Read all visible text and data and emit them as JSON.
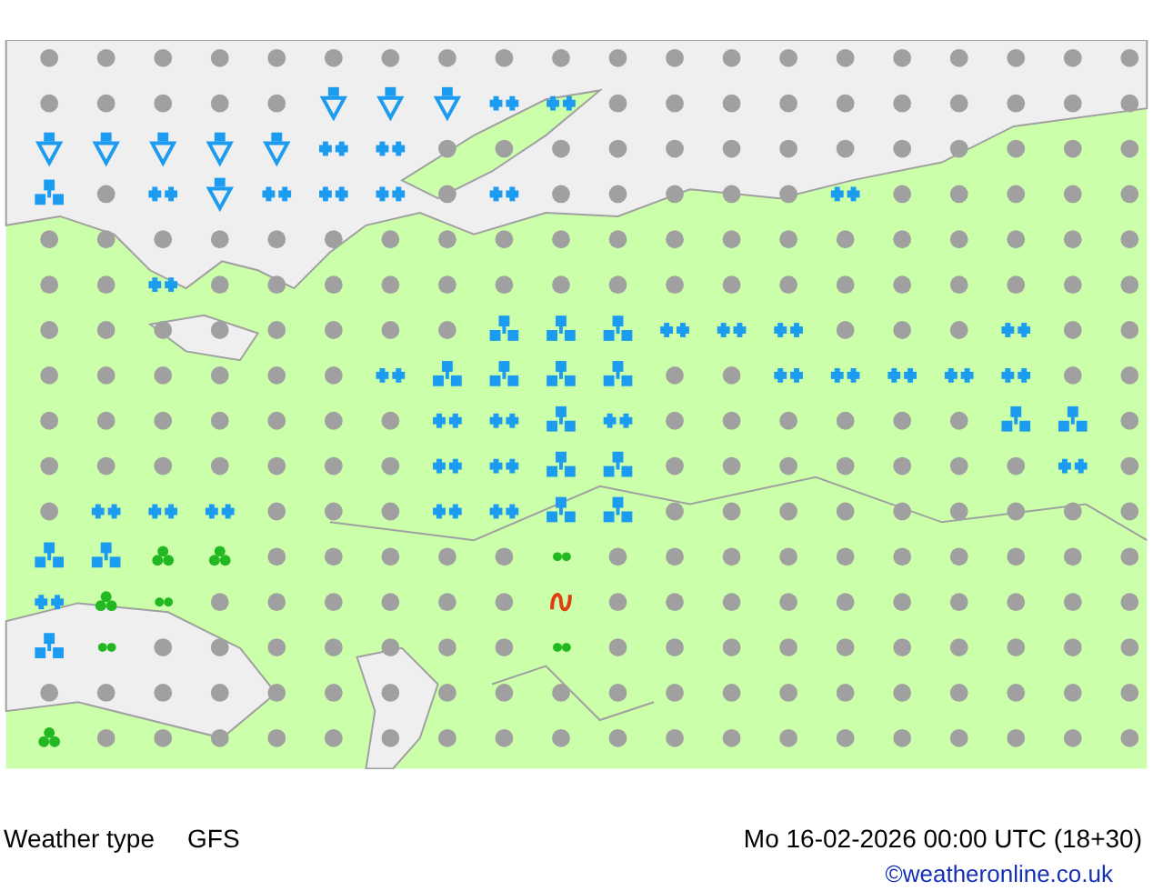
{
  "footer": {
    "title": "Weather type",
    "model": "GFS",
    "datetime": "Mo 16-02-2026 00:00 UTC (18+30)",
    "credit": "©weatheronline.co.uk"
  }
}
